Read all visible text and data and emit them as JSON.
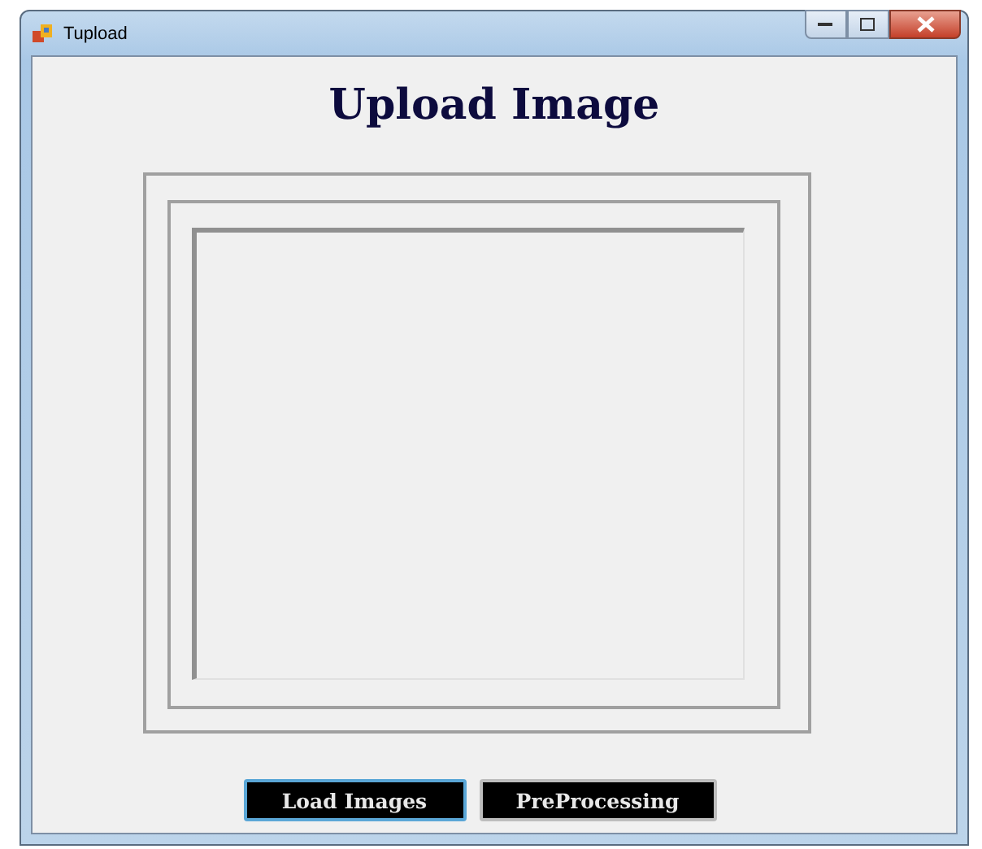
{
  "window": {
    "title": "Tupload"
  },
  "heading": "Upload Image",
  "buttons": [
    {
      "label": "Load Images",
      "focused": true
    },
    {
      "label": "PreProcessing",
      "focused": false
    }
  ]
}
